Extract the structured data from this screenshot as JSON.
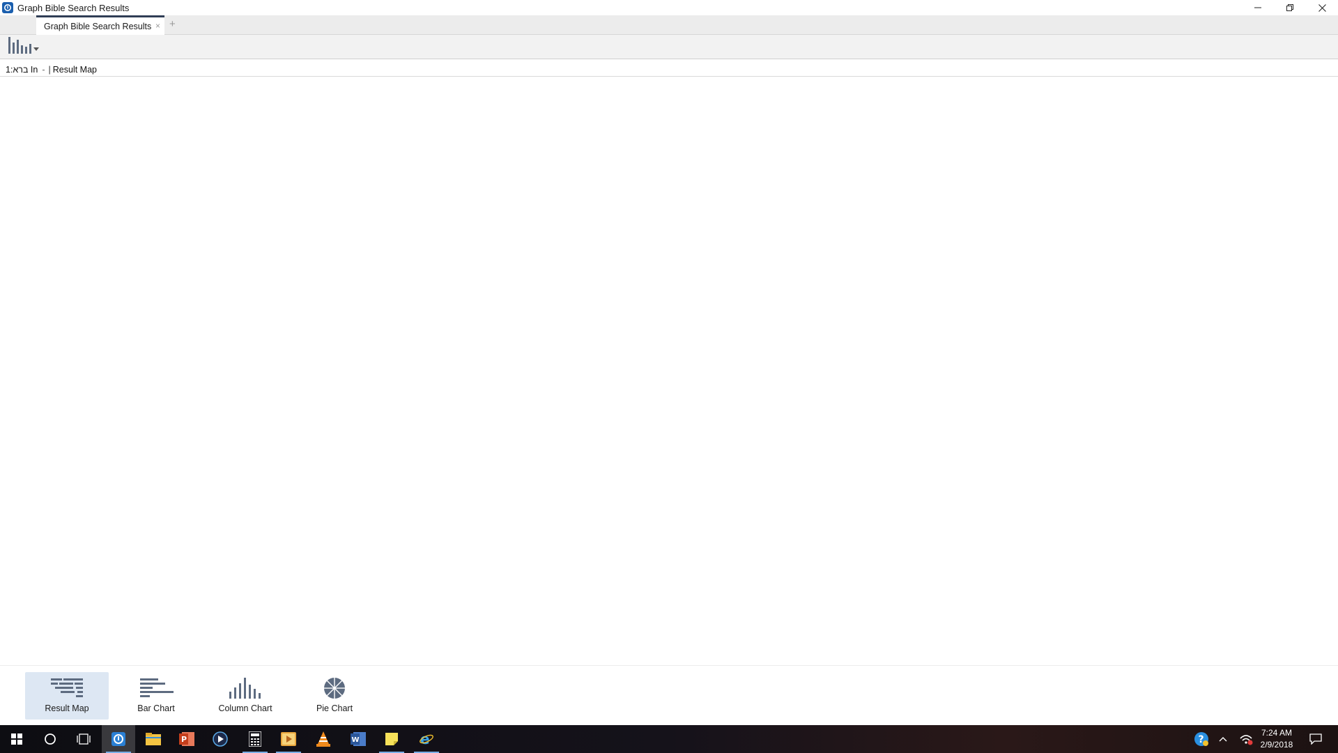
{
  "window": {
    "title": "Graph Bible Search Results"
  },
  "tabs": [
    {
      "label": "Graph Bible Search Results",
      "close": "×"
    }
  ],
  "tab_add": "+",
  "reference": {
    "query": "1:ברא In",
    "dash": "-",
    "separator": "|",
    "view": "Result Map"
  },
  "chart_buttons": [
    {
      "label": "Result Map",
      "icon": "result-map-icon",
      "active": true
    },
    {
      "label": "Bar Chart",
      "icon": "bar-chart-icon",
      "active": false
    },
    {
      "label": "Column Chart",
      "icon": "column-chart-icon",
      "active": false
    },
    {
      "label": "Pie Chart",
      "icon": "pie-chart-icon",
      "active": false
    }
  ],
  "taskbar": {
    "apps": [
      {
        "icon": "windows-start-icon"
      },
      {
        "icon": "cortana-search-icon"
      },
      {
        "icon": "task-view-icon"
      },
      {
        "icon": "logos-app-icon",
        "active": true
      },
      {
        "icon": "file-explorer-icon"
      },
      {
        "icon": "powerpoint-icon"
      },
      {
        "icon": "media-player-icon"
      },
      {
        "icon": "calculator-icon"
      },
      {
        "icon": "video-app-icon"
      },
      {
        "icon": "vlc-icon"
      },
      {
        "icon": "word-icon"
      },
      {
        "icon": "sticky-notes-icon"
      },
      {
        "icon": "internet-explorer-icon"
      }
    ],
    "clock_time": "7:24 AM",
    "clock_date": "2/9/2018"
  },
  "colors": {
    "tab_accent": "#2f3d55",
    "active_chart_bg": "#dde7f3",
    "icon_gray": "#5d6b80",
    "app_blue": "#1b5fae"
  }
}
